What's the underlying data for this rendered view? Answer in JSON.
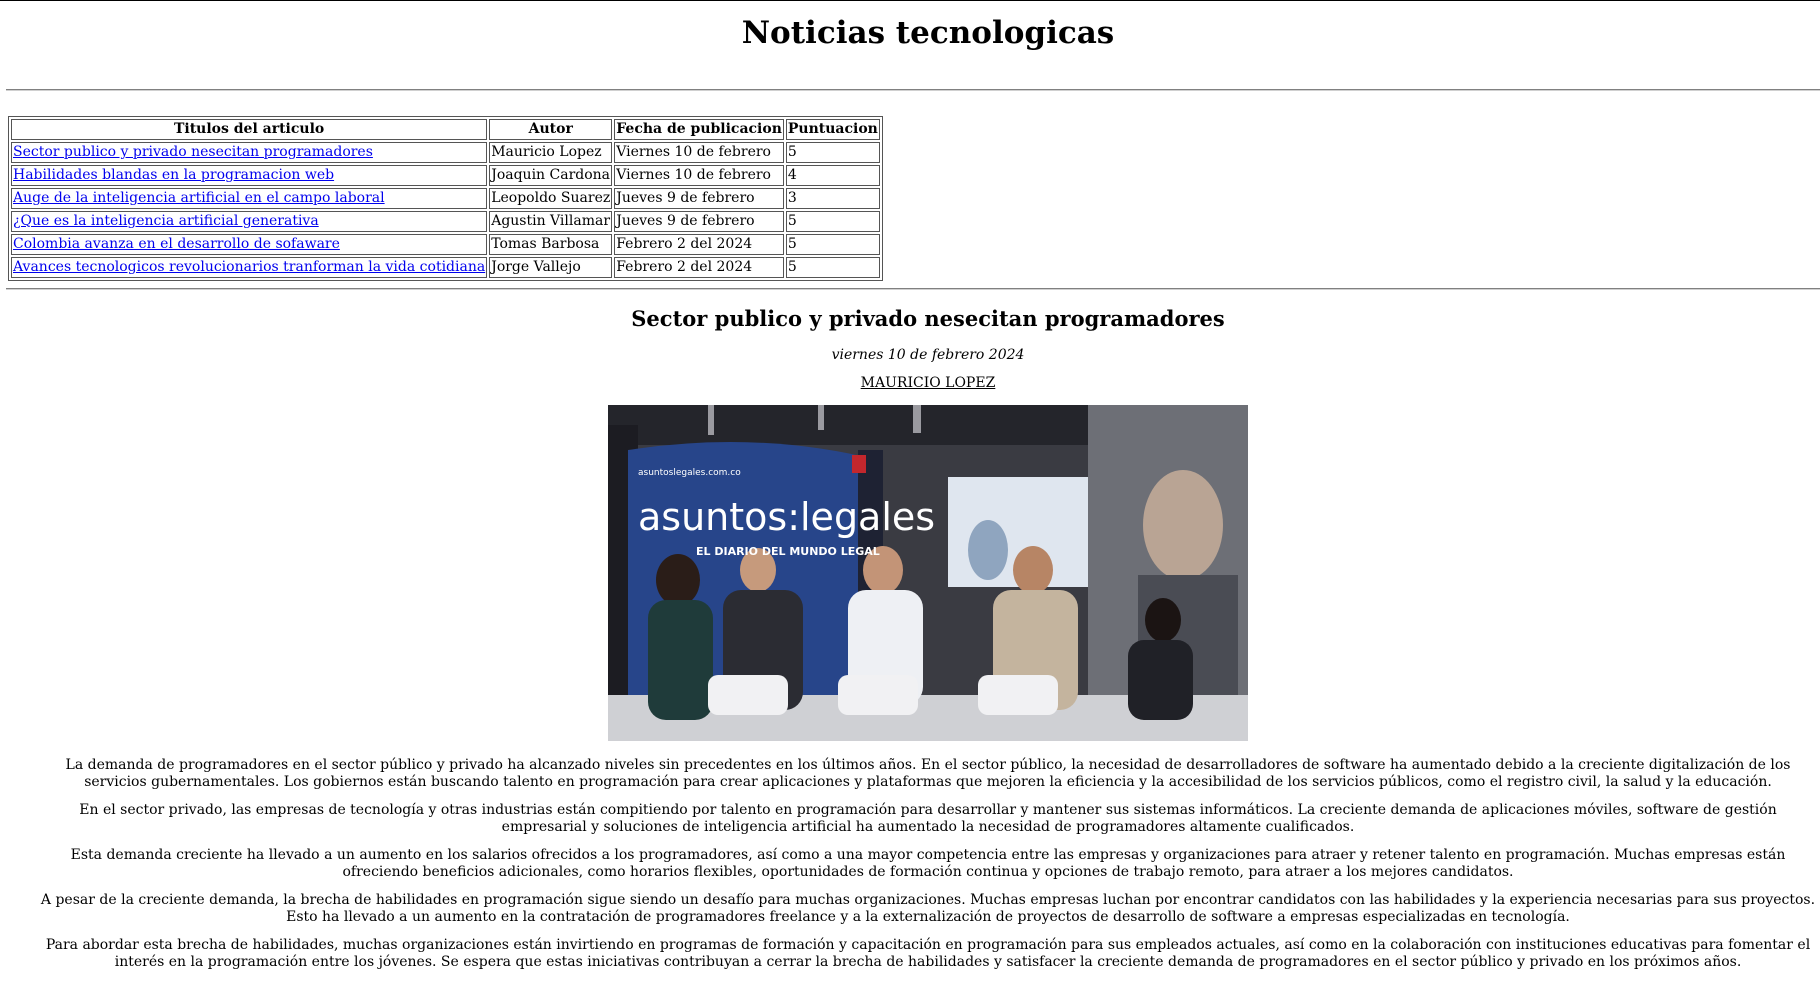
{
  "page": {
    "heading": "Noticias tecnologicas"
  },
  "table": {
    "headers": [
      "Titulos del articulo",
      "Autor",
      "Fecha de publicacion",
      "Puntuacion"
    ],
    "rows": [
      {
        "title": "Sector publico y privado nesecitan programadores",
        "author": "Mauricio Lopez",
        "date": "Viernes 10 de febrero",
        "score": "5"
      },
      {
        "title": "Habilidades blandas en la programacion web",
        "author": "Joaquin Cardona",
        "date": "Viernes 10 de febrero",
        "score": "4"
      },
      {
        "title": "Auge de la inteligencia artificial en el campo laboral",
        "author": "Leopoldo Suarez",
        "date": "Jueves 9 de febrero",
        "score": "3"
      },
      {
        "title": "¿Que es la inteligencia artificial generativa",
        "author": "Agustin Villamar",
        "date": "Jueves 9 de febrero",
        "score": "5"
      },
      {
        "title": "Colombia avanza en el desarrollo de sofaware",
        "author": "Tomas Barbosa",
        "date": "Febrero 2 del 2024",
        "score": "5"
      },
      {
        "title": "Avances tecnologicos revolucionarios tranforman la vida cotidiana",
        "author": "Jorge Vallejo",
        "date": "Febrero 2 del 2024",
        "score": "5"
      }
    ]
  },
  "article": {
    "title": "Sector publico y privado nesecitan programadores",
    "date": "viernes 10 de febrero 2024",
    "author": "MAURICIO LOPEZ",
    "image_text": {
      "site": "asuntoslegales.com.co",
      "brand": "asuntos:legales",
      "tagline": "EL DIARIO DEL MUNDO LEGAL"
    },
    "paragraphs": [
      "La demanda de programadores en el sector público y privado ha alcanzado niveles sin precedentes en los últimos años. En el sector público, la necesidad de desarrolladores de software ha aumentado debido a la creciente digitalización de los servicios gubernamentales. Los gobiernos están buscando talento en programación para crear aplicaciones y plataformas que mejoren la eficiencia y la accesibilidad de los servicios públicos, como el registro civil, la salud y la educación.",
      "En el sector privado, las empresas de tecnología y otras industrias están compitiendo por talento en programación para desarrollar y mantener sus sistemas informáticos. La creciente demanda de aplicaciones móviles, software de gestión empresarial y soluciones de inteligencia artificial ha aumentado la necesidad de programadores altamente cualificados.",
      "Esta demanda creciente ha llevado a un aumento en los salarios ofrecidos a los programadores, así como a una mayor competencia entre las empresas y organizaciones para atraer y retener talento en programación. Muchas empresas están ofreciendo beneficios adicionales, como horarios flexibles, oportunidades de formación continua y opciones de trabajo remoto, para atraer a los mejores candidatos.",
      "A pesar de la creciente demanda, la brecha de habilidades en programación sigue siendo un desafío para muchas organizaciones. Muchas empresas luchan por encontrar candidatos con las habilidades y la experiencia necesarias para sus proyectos. Esto ha llevado a un aumento en la contratación de programadores freelance y a la externalización de proyectos de desarrollo de software a empresas especializadas en tecnología.",
      "Para abordar esta brecha de habilidades, muchas organizaciones están invirtiendo en programas de formación y capacitación en programación para sus empleados actuales, así como en la colaboración con instituciones educativas para fomentar el interés en la programación entre los jóvenes. Se espera que estas iniciativas contribuyan a cerrar la brecha de habilidades y satisfacer la creciente demanda de programadores en el sector público y privado en los próximos años."
    ]
  }
}
